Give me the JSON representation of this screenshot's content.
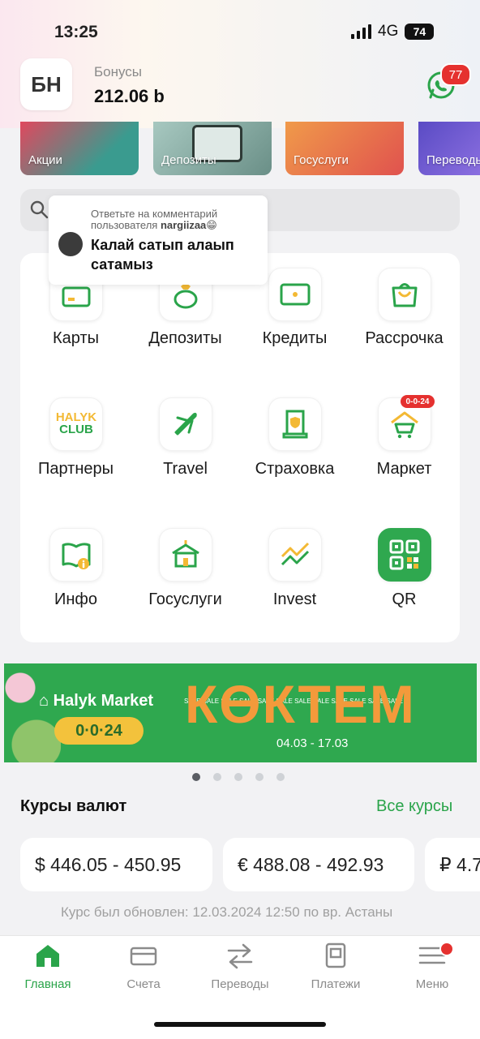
{
  "status_bar": {
    "time": "13:25",
    "network": "4G",
    "battery": "74"
  },
  "header": {
    "avatar_initials": "БН",
    "bonus_label": "Бонусы",
    "bonus_value": "212.06 b",
    "notifications_count": "77"
  },
  "promo_tiles": [
    {
      "label": "Акции",
      "color": "#d9485c"
    },
    {
      "label": "Депозиты",
      "color": "#8fb0a8"
    },
    {
      "label": "Госуслуги",
      "color": "#e86b5e"
    },
    {
      "label": "Переводы",
      "color": "#7c6bd6"
    }
  ],
  "tooltip": {
    "line1": "Ответьте на комментарий",
    "line2_prefix": "пользователя ",
    "username": "nargiizaa",
    "emoji": "😁",
    "text": "Калай сатып алаып сатамыз"
  },
  "services": [
    {
      "label": "Карты",
      "icon": "card-icon"
    },
    {
      "label": "Депозиты",
      "icon": "money-bag-icon"
    },
    {
      "label": "Кредиты",
      "icon": "cash-icon"
    },
    {
      "label": "Рассрочка",
      "icon": "shopping-bag-icon"
    },
    {
      "label": "Партнеры",
      "icon": "halyk-club-icon",
      "logo_line1": "HALYK",
      "logo_line2": "CLUB"
    },
    {
      "label": "Travel",
      "icon": "airplane-icon"
    },
    {
      "label": "Страховка",
      "icon": "insurance-icon"
    },
    {
      "label": "Маркет",
      "icon": "market-cart-icon",
      "badge": "0-0-24"
    },
    {
      "label": "Инфо",
      "icon": "info-book-icon"
    },
    {
      "label": "Госуслуги",
      "icon": "gov-building-icon"
    },
    {
      "label": "Invest",
      "icon": "invest-chart-icon"
    },
    {
      "label": "QR",
      "icon": "qr-icon"
    }
  ],
  "banner": {
    "logo": "Halyk Market",
    "pill": "0·0·24",
    "title": "КӨКТЕМ",
    "sale_text": "SALE SALE SALE SALE SALE SALE SALE SALE SALE SALE SALE SALE",
    "dates": "04.03 - 17.03",
    "slides": 5,
    "active_slide": 1
  },
  "rates": {
    "title": "Курсы валют",
    "link": "Все курсы",
    "cards": [
      {
        "text": "$ 446.05 - 450.95"
      },
      {
        "text": "€ 488.08 - 492.93"
      },
      {
        "text": "₽ 4.7"
      }
    ],
    "note": "Курс был обновлен: 12.03.2024 12:50 по вр. Астаны"
  },
  "tabs": [
    {
      "label": "Главная",
      "icon": "home-icon",
      "active": true
    },
    {
      "label": "Счета",
      "icon": "cards-icon"
    },
    {
      "label": "Переводы",
      "icon": "transfer-icon"
    },
    {
      "label": "Платежи",
      "icon": "payments-icon"
    },
    {
      "label": "Меню",
      "icon": "menu-icon"
    }
  ],
  "colors": {
    "accent": "#2aa44a",
    "badge": "#e5312f"
  }
}
